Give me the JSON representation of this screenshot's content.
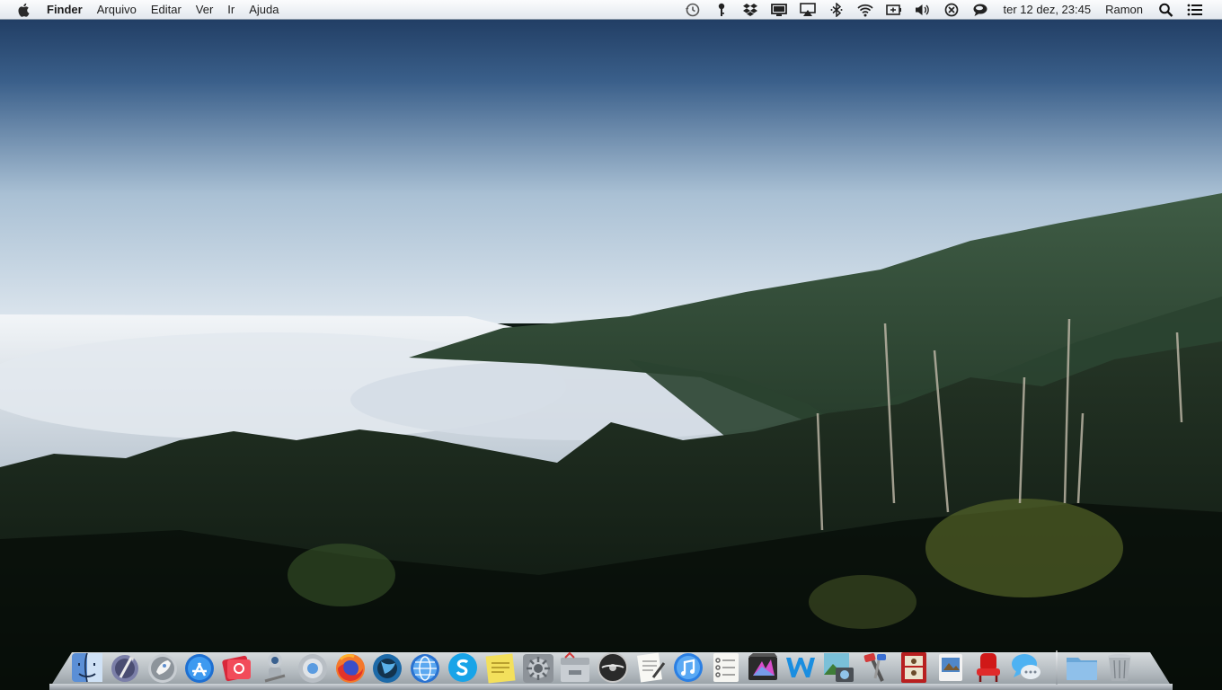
{
  "menubar": {
    "apple_icon": "apple-logo-icon",
    "app_name": "Finder",
    "menus": [
      "Arquivo",
      "Editar",
      "Ver",
      "Ir",
      "Ajuda"
    ],
    "status_icons": [
      "time-machine-icon",
      "keychain-key-icon",
      "dropbox-icon",
      "display-icon",
      "airplay-icon",
      "bluetooth-icon",
      "wifi-icon",
      "battery-icon",
      "volume-icon",
      "sync-icon",
      "chat-bubble-icon"
    ],
    "clock": "ter 12 dez, 23:45",
    "user": "Ramon",
    "spotlight_icon": "search-icon",
    "notifications_icon": "list-icon"
  },
  "dock": {
    "apps": [
      "finder",
      "launchpad",
      "rocket",
      "app-store",
      "flashcard",
      "automator",
      "chrome",
      "firefox",
      "thunderbird",
      "globe-browser",
      "skype",
      "stickies",
      "system-preferences",
      "archive-utility",
      "dvd-player",
      "textedit",
      "itunes",
      "reminders",
      "final-cut-pro",
      "wps-writer",
      "image-capture",
      "terminal-tools",
      "photo-booth",
      "preview",
      "cinema-seat",
      "messages"
    ],
    "folders": [
      "documents-folder",
      "trash"
    ]
  },
  "colors": {
    "sky_top": "#1f3a63",
    "sky_horizon": "#d8e3ec",
    "menubar_bg": "#eef2f6"
  }
}
